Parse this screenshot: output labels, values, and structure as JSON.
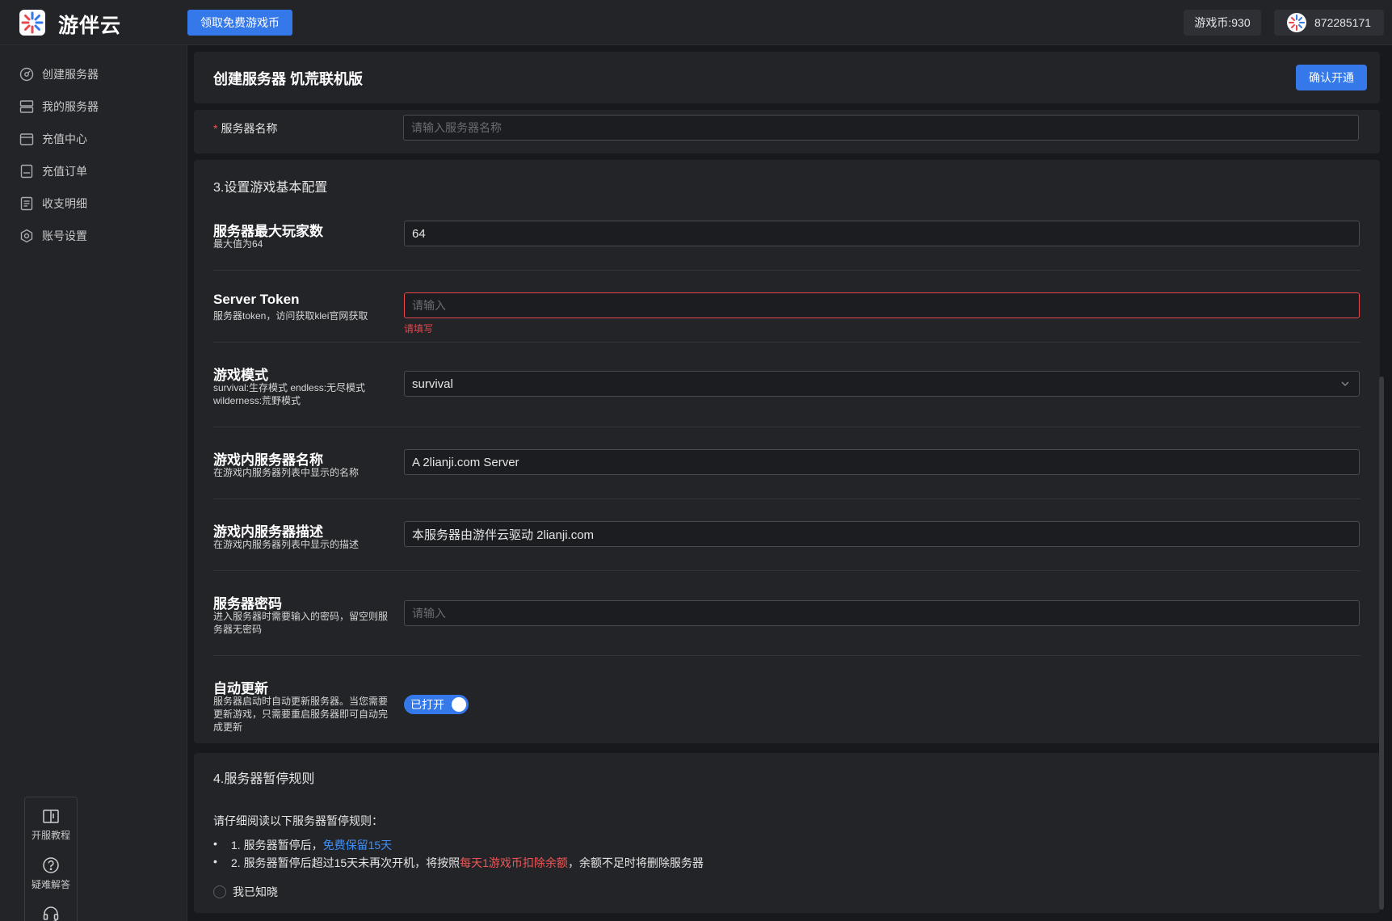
{
  "app": {
    "brand": "游伴云",
    "free_coin_button": "领取免费游戏币",
    "coin_balance": "游戏币:930",
    "user_id": "872285171"
  },
  "sidebar": {
    "items": [
      {
        "label": "创建服务器",
        "icon": "create-server-icon"
      },
      {
        "label": "我的服务器",
        "icon": "server-list-icon"
      },
      {
        "label": "充值中心",
        "icon": "wallet-icon"
      },
      {
        "label": "充值订单",
        "icon": "order-icon"
      },
      {
        "label": "收支明细",
        "icon": "ledger-icon"
      },
      {
        "label": "账号设置",
        "icon": "settings-icon"
      }
    ],
    "helpers": [
      {
        "label": "开服教程",
        "icon": "book-icon"
      },
      {
        "label": "疑难解答",
        "icon": "question-icon"
      },
      {
        "label": "客服",
        "icon": "headset-icon"
      }
    ]
  },
  "header": {
    "title": "创建服务器 饥荒联机版",
    "confirm_button": "确认开通"
  },
  "server_name": {
    "label": "服务器名称",
    "placeholder": "请输入服务器名称"
  },
  "config": {
    "section_title": "3.设置游戏基本配置",
    "max_players": {
      "title": "服务器最大玩家数",
      "desc": "最大值为64",
      "value": "64"
    },
    "token": {
      "title": "Server Token",
      "desc": "服务器token，访问获取klei官网获取",
      "placeholder": "请输入",
      "error": "请填写"
    },
    "mode": {
      "title": "游戏模式",
      "desc_line1": "survival:生存模式 endless:无尽模式",
      "desc_line2": "wilderness:荒野模式",
      "value": "survival"
    },
    "ingame_name": {
      "title": "游戏内服务器名称",
      "desc": "在游戏内服务器列表中显示的名称",
      "value": "A 2lianji.com Server"
    },
    "ingame_desc": {
      "title": "游戏内服务器描述",
      "desc": "在游戏内服务器列表中显示的描述",
      "value": "本服务器由游伴云驱动 2lianji.com"
    },
    "password": {
      "title": "服务器密码",
      "desc": "进入服务器时需要输入的密码，留空则服务器无密码",
      "placeholder": "请输入"
    },
    "auto_update": {
      "title": "自动更新",
      "desc": "服务器启动时自动更新服务器。当您需要更新游戏，只需要重启服务器即可自动完成更新",
      "toggle_label": "已打开",
      "enabled": true
    }
  },
  "rules": {
    "section_title": "4.服务器暂停规则",
    "intro": "请仔细阅读以下服务器暂停规则：",
    "rule1_prefix": "1. 服务器暂停后，",
    "rule1_highlight": "免费保留15天",
    "rule2_prefix": "2. 服务器暂停后超过15天未再次开机，将按照",
    "rule2_highlight": "每天1游戏币扣除余额",
    "rule2_suffix": "，余额不足时将删除服务器",
    "agree_label": "我已知晓"
  },
  "colors": {
    "accent": "#3478ea",
    "error": "#e5484d",
    "link_blue": "#3f8ef5",
    "warning_red": "#f05656",
    "background": "#18191c",
    "panel": "#232428"
  }
}
